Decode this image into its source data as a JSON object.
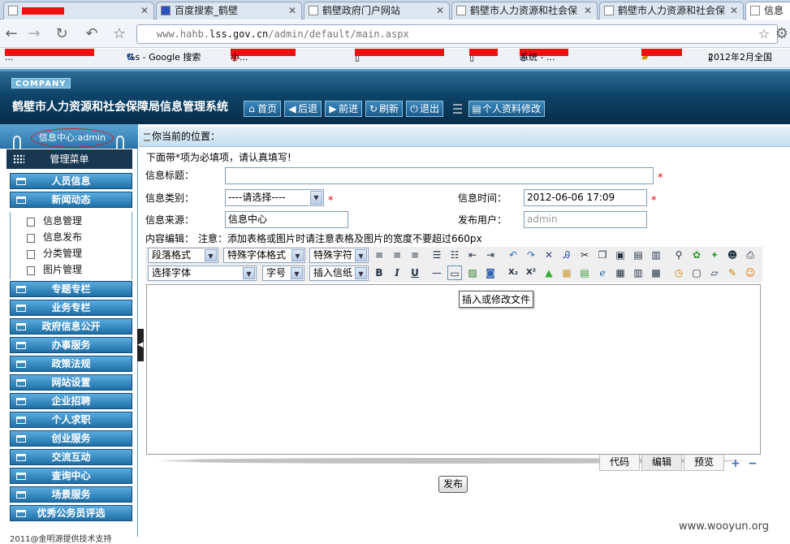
{
  "browser": {
    "tabs": [
      {
        "label": "",
        "redacted": true
      },
      {
        "label": "百度搜索_鹤壁"
      },
      {
        "label": "鹤壁政府门户网站"
      },
      {
        "label": "鹤壁市人力资源和社会保"
      },
      {
        "label": "鹤壁市人力资源和社会保"
      },
      {
        "label": "信息"
      }
    ],
    "url_prefix": "www.hahb.",
    "url_domain": "lss.gov.cn",
    "url_path": "/admin/default/main.aspx",
    "bookmarks": [
      {
        "label": "..."
      },
      {
        "label": "%s - Google 搜索"
      },
      {
        "label": "小..."
      },
      {
        "label": ""
      },
      {
        "label": ""
      },
      {
        "label": "系统 - ..."
      },
      {
        "label": ""
      },
      {
        "label": "2012年2月全国"
      }
    ]
  },
  "header": {
    "company": "COMPANY",
    "title": "鹤壁市人力资源和社会保障局信息管理系统",
    "buttons": {
      "home": "首页",
      "back": "后退",
      "forward": "前进",
      "refresh": "刷新",
      "logout": "退出",
      "profile": "个人资料修改"
    }
  },
  "sidebar": {
    "info_center": "信息中心:admin",
    "menu_title": "管理菜单",
    "items_top": [
      {
        "label": "人员信息"
      },
      {
        "label": "新闻动态"
      }
    ],
    "sub_items": [
      {
        "label": "信息管理"
      },
      {
        "label": "信息发布"
      },
      {
        "label": "分类管理"
      },
      {
        "label": "图片管理"
      }
    ],
    "items_bottom": [
      {
        "label": "专题专栏"
      },
      {
        "label": "业务专栏"
      },
      {
        "label": "政府信息公开"
      },
      {
        "label": "办事服务"
      },
      {
        "label": "政策法规"
      },
      {
        "label": "网站设置"
      },
      {
        "label": "企业招聘"
      },
      {
        "label": "个人求职"
      },
      {
        "label": "创业服务"
      },
      {
        "label": "交流互动"
      },
      {
        "label": "查询中心"
      },
      {
        "label": "场景服务"
      },
      {
        "label": "优秀公务员评选"
      }
    ],
    "footer": "2011@金明源提供技术支持"
  },
  "location": {
    "label": "你当前的位置："
  },
  "form": {
    "note": "下面带*项为必填项，请认真填写!",
    "title_label": "信息标题：",
    "title_value": "",
    "category_label": "信息类别：",
    "category_value": "----请选择----",
    "time_label": "信息时间：",
    "time_value": "2012-06-06 17:09",
    "source_label": "信息来源：",
    "source_value": "信息中心",
    "user_label": "发布用户：",
    "user_value": "admin",
    "editor_label": "内容编辑：",
    "editor_note": "注意：添加表格或图片时请注意表格及图片的宽度不要超过660px",
    "required_mark": "*",
    "publish": "发布"
  },
  "editor": {
    "selects": {
      "paragraph": "段落格式",
      "special_font": "特殊字体格式",
      "special_char": "特殊字符",
      "font": "选择字体",
      "size": "字号",
      "letterhead": "插入信纸"
    },
    "tooltip": "插入或修改文件",
    "modes": {
      "code": "代码",
      "edit": "编辑",
      "preview": "预览"
    }
  },
  "watermark": "www.wooyun.org"
}
